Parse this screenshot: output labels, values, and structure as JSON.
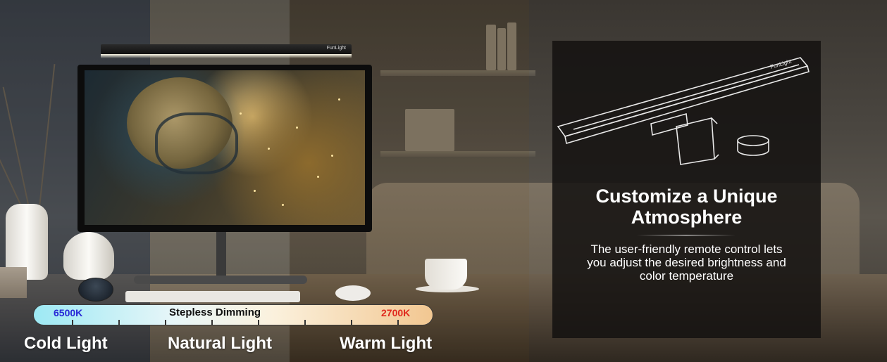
{
  "lightbar": {
    "brand": "FunLight"
  },
  "slider": {
    "cold_temp": "6500K",
    "title": "Stepless Dimming",
    "warm_temp": "2700K",
    "colors": {
      "cold": "#2727d6",
      "warm": "#e0281d"
    }
  },
  "labels": {
    "cold": "Cold Light",
    "natural": "Natural Light",
    "warm": "Warm Light"
  },
  "feature": {
    "title_line1": "Customize a Unique",
    "title_line2": "Atmosphere",
    "desc_line1": "The user-friendly remote control lets",
    "desc_line2": "you adjust the desired brightness and",
    "desc_line3": "color temperature",
    "illustration_brand": "FunLight"
  }
}
